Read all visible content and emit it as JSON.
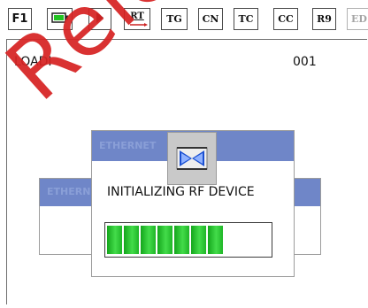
{
  "toolbar": {
    "f1_label": "F1",
    "battery_icon": "battery-icon",
    "play_icon": "play-icon",
    "rt_label": "RT",
    "tg_label": "TG",
    "cn_label": "CN",
    "tc_label": "TC",
    "cc_label": "CC",
    "r9_label": "R9",
    "ed_label": "ED"
  },
  "back_dialog": {
    "loading_label": "LOADI",
    "loading_value": "001"
  },
  "front_dialog": {
    "status_text": "INITIALIZING RF DEVICE",
    "progress": {
      "filled_segments": 7,
      "segment_color": "#2fc83a"
    }
  },
  "colors": {
    "titlebar": "#6f86c8",
    "border": "#4a4a4a",
    "battery_green": "#22c322",
    "watermark": "#d62222"
  },
  "watermark": {
    "text": "Release"
  }
}
